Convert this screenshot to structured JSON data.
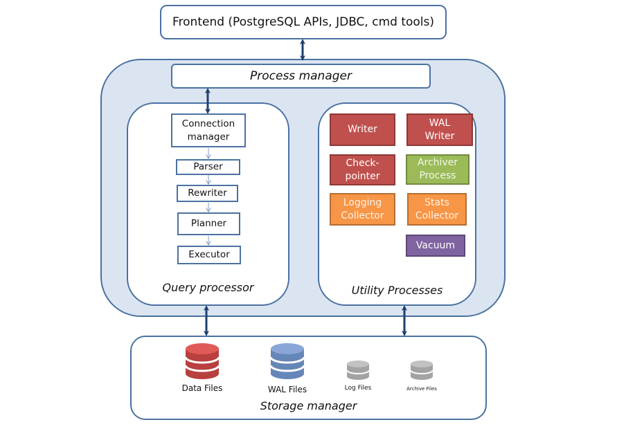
{
  "frontend": {
    "label": "Frontend (PostgreSQL APIs, JDBC, cmd tools)"
  },
  "process_manager": {
    "label": "Process manager"
  },
  "query_processor": {
    "title": "Query processor",
    "steps": [
      {
        "label": "Connection manager"
      },
      {
        "label": "Parser"
      },
      {
        "label": "Rewriter"
      },
      {
        "label": "Planner"
      },
      {
        "label": "Executor"
      }
    ]
  },
  "utility_processes": {
    "title": "Utility Processes",
    "processes": [
      {
        "label": "Writer",
        "color": "#c0504d"
      },
      {
        "label": "WAL Writer",
        "color": "#c0504d"
      },
      {
        "label": "Check-pointer",
        "color": "#c0504d"
      },
      {
        "label": "Archiver Process",
        "color": "#9bbb59"
      },
      {
        "label": "Logging Collector",
        "color": "#f79646"
      },
      {
        "label": "Stats Collector",
        "color": "#f79646"
      },
      {
        "label": "Vacuum",
        "color": "#8064a2"
      }
    ]
  },
  "storage_manager": {
    "title": "Storage manager",
    "stores": [
      {
        "label": "Data Files",
        "color": "#c0504d"
      },
      {
        "label": "WAL Files",
        "color": "#4f81bd"
      },
      {
        "label": "Log Files",
        "color": "#a6a6a6"
      },
      {
        "label": "Archive Files",
        "color": "#a6a6a6"
      }
    ]
  },
  "colors": {
    "border": "#4a71a1",
    "container_fill": "#dbe5f1",
    "arrow": "#1f3f6e"
  }
}
